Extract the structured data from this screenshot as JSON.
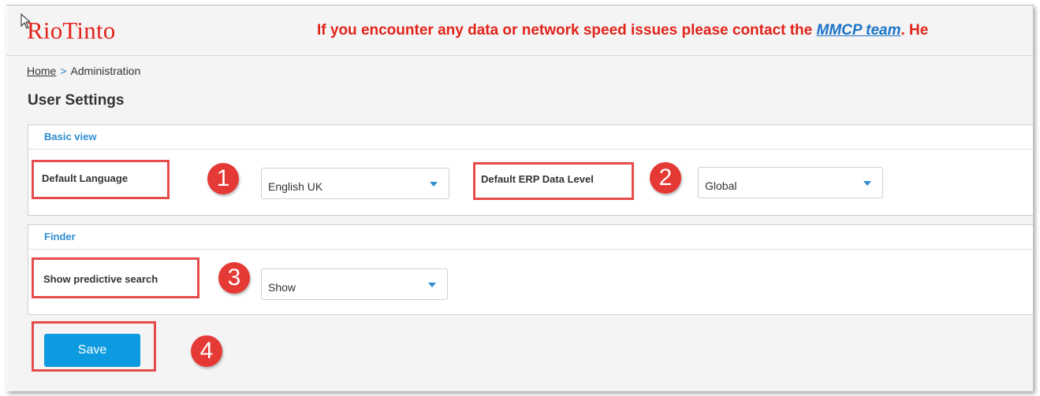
{
  "header": {
    "logo_text": "RioTinto",
    "banner_prefix": "If you encounter any data or network speed issues please contact the ",
    "banner_link": "MMCP team",
    "banner_suffix": ". He"
  },
  "breadcrumb": {
    "home": "Home",
    "separator": ">",
    "current": "Administration"
  },
  "page_title": "User Settings",
  "sections": {
    "basic_view": {
      "title": "Basic view",
      "default_language": {
        "label": "Default Language",
        "value": "English UK"
      },
      "default_erp": {
        "label": "Default ERP Data Level",
        "value": "Global"
      }
    },
    "finder": {
      "title": "Finder",
      "predictive_search": {
        "label": "Show predictive search",
        "value": "Show"
      }
    }
  },
  "save_label": "Save",
  "annotations": [
    "1",
    "2",
    "3",
    "4"
  ],
  "colors": {
    "brand_red": "#e2231a",
    "accent_blue": "#2e8dd1",
    "button_blue": "#0c9be0",
    "annotation_red": "#e53935"
  }
}
